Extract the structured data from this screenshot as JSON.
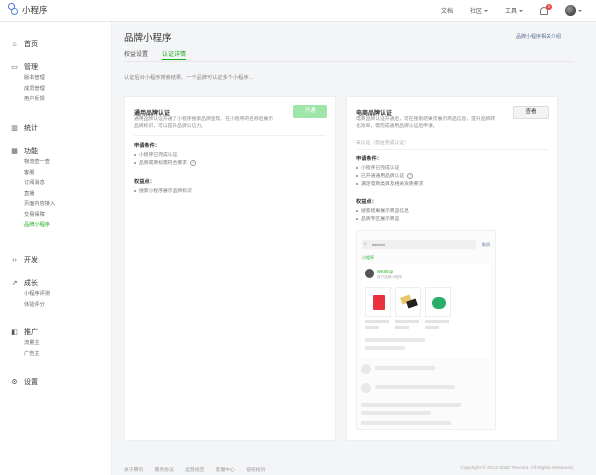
{
  "app": {
    "name": "小程序"
  },
  "topbar": {
    "items": [
      "文档",
      "社区",
      "工具"
    ],
    "notification_count": "2"
  },
  "sidebar": [
    {
      "icon": "home-icon",
      "label": "首页",
      "items": []
    },
    {
      "icon": "folder-icon",
      "label": "管理",
      "items": [
        "版本管理",
        "成员管理",
        "用户反馈"
      ]
    },
    {
      "icon": "chart-icon",
      "label": "统计",
      "items": []
    },
    {
      "icon": "function-icon",
      "label": "功能",
      "items": [
        "物流查一查",
        "客服",
        "订阅消息",
        "直播",
        "页面内容接入",
        "交易保障",
        "品牌小程序"
      ]
    },
    {
      "icon": "code-icon",
      "label": "开发",
      "items": []
    },
    {
      "icon": "growth-icon",
      "label": "成长",
      "items": [
        "小程序评测",
        "体验评分"
      ]
    },
    {
      "icon": "promote-icon",
      "label": "推广",
      "items": [
        "流量主",
        "广告主"
      ]
    },
    {
      "icon": "settings-icon",
      "label": "设置",
      "items": []
    }
  ],
  "page": {
    "title": "品牌小程序",
    "header_link": "品牌小程序相关介绍",
    "tabs": [
      "权益设置",
      "认证详情"
    ],
    "description": "认证后对小程序搜索结果、一个品牌可认证多个小程序…"
  },
  "left_card": {
    "title": "通用品牌认证",
    "description": "通用品牌认证开通了小程序搜索品牌呈现、在小程序的名称后展示品牌标识，可以提升品牌公信力。",
    "button": "开通",
    "apply_heading": "申请条件：",
    "apply_items": [
      "小程序已完成认证",
      "品牌或商标需符合要求"
    ],
    "rights_heading": "权益点：",
    "rights_items": [
      "搜索小程序展示品牌标识"
    ]
  },
  "right_card": {
    "title": "电商品牌认证",
    "description": "电商品牌认证开通后，可在搜索结果页展示商品信息，提升品牌转化效率，需完成通用品牌认证后申请。",
    "status": "未认证（前往完成认证）",
    "button": "查看",
    "apply_heading": "申请条件：",
    "apply_items": [
      "小程序已完成认证",
      "已开通通用品牌认证",
      "满足电商类目及相关资质要求"
    ],
    "rights_heading": "权益点：",
    "rights_items": [
      "搜索结果展示商品信息",
      "品牌专区展示商品"
    ],
    "preview": {
      "search_text": "wechat",
      "cancel": "取消",
      "tab": "小程序",
      "account": "WeShop",
      "account_sub": "官方品牌小程序"
    }
  },
  "footer": {
    "links": [
      "关于腾讯",
      "服务协议",
      "运营规范",
      "客服中心",
      "侵权投诉"
    ],
    "copyright": "Copyright © 2012-2020 Tencent. All Rights Reserved."
  },
  "colors": {
    "accent": "#1aad19",
    "link": "#576b95"
  }
}
